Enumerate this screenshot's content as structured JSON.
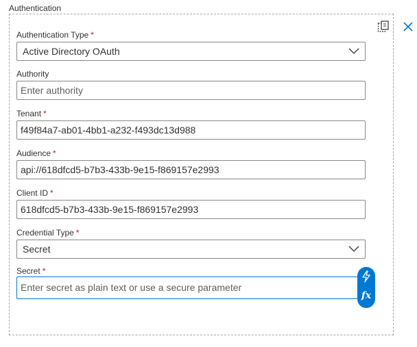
{
  "group": {
    "label": "Authentication"
  },
  "fields": {
    "auth_type": {
      "label": "Authentication Type",
      "required": "*",
      "value": "Active Directory OAuth"
    },
    "authority": {
      "label": "Authority",
      "placeholder": "Enter authority"
    },
    "tenant": {
      "label": "Tenant",
      "required": "*",
      "value": "f49f84a7-ab01-4bb1-a232-f493dc13d988"
    },
    "audience": {
      "label": "Audience",
      "required": "*",
      "value": "api://618dfcd5-b7b3-433b-9e15-f869157e2993"
    },
    "client_id": {
      "label": "Client ID",
      "required": "*",
      "value": "618dfcd5-b7b3-433b-9e15-f869157e2993"
    },
    "credential_type": {
      "label": "Credential Type",
      "required": "*",
      "value": "Secret"
    },
    "secret": {
      "label": "Secret",
      "required": "*",
      "placeholder": "Enter secret as plain text or use a secure parameter"
    }
  },
  "dynamic_content": {
    "fx_label": "fx"
  },
  "icons": {
    "copy": "copy-icon",
    "close": "close-icon",
    "chevron": "chevron-down-icon",
    "bolt": "lightning-icon"
  },
  "colors": {
    "accent": "#0078d4",
    "required": "#a4262c",
    "border": "#8a8886"
  }
}
